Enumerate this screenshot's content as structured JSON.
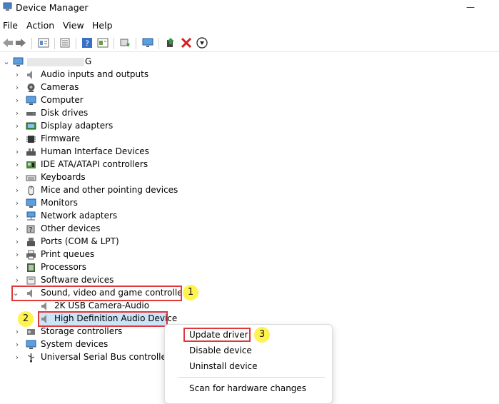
{
  "window": {
    "title": "Device Manager",
    "controls": {
      "minimize": "—",
      "close": "✕"
    }
  },
  "menu": [
    "File",
    "Action",
    "View",
    "Help"
  ],
  "toolbar": {
    "icons": [
      "back-icon",
      "forward-icon",
      "properties-icon",
      "show-hide-icon",
      "help-icon",
      "view-icon",
      "update-driver-icon",
      "scan-monitor-icon",
      "enable-device-icon",
      "uninstall-icon",
      "download-icon"
    ]
  },
  "tree": {
    "root_suffix": "G",
    "categories": [
      {
        "label": "Audio inputs and outputs",
        "icon": "speaker-icon"
      },
      {
        "label": "Cameras",
        "icon": "camera-icon"
      },
      {
        "label": "Computer",
        "icon": "computer-icon"
      },
      {
        "label": "Disk drives",
        "icon": "disk-icon"
      },
      {
        "label": "Display adapters",
        "icon": "display-icon"
      },
      {
        "label": "Firmware",
        "icon": "chip-icon"
      },
      {
        "label": "Human Interface Devices",
        "icon": "hid-icon"
      },
      {
        "label": "IDE ATA/ATAPI controllers",
        "icon": "controller-icon"
      },
      {
        "label": "Keyboards",
        "icon": "keyboard-icon"
      },
      {
        "label": "Mice and other pointing devices",
        "icon": "mouse-icon"
      },
      {
        "label": "Monitors",
        "icon": "monitor-icon"
      },
      {
        "label": "Network adapters",
        "icon": "network-icon"
      },
      {
        "label": "Other devices",
        "icon": "unknown-device-icon"
      },
      {
        "label": "Ports (COM & LPT)",
        "icon": "port-icon"
      },
      {
        "label": "Print queues",
        "icon": "printer-icon"
      },
      {
        "label": "Processors",
        "icon": "processor-icon"
      },
      {
        "label": "Software devices",
        "icon": "software-icon"
      },
      {
        "label": "Sound, video and game controllers",
        "icon": "speaker-icon"
      },
      {
        "label": "2K USB Camera-Audio",
        "icon": "speaker-icon"
      },
      {
        "label": "High Definition Audio Device",
        "icon": "speaker-icon"
      },
      {
        "label": "Storage controllers",
        "icon": "storage-icon"
      },
      {
        "label": "System devices",
        "icon": "system-icon"
      },
      {
        "label": "Universal Serial Bus controllers",
        "icon": "usb-icon"
      }
    ]
  },
  "context_menu": {
    "items": [
      "Update driver",
      "Disable device",
      "Uninstall device",
      "Scan for hardware changes"
    ]
  },
  "annotations": [
    "1",
    "2",
    "3"
  ],
  "colors": {
    "highlight_border": "#e0373a",
    "selection": "#cce4f7",
    "badge": "#fff34d"
  }
}
